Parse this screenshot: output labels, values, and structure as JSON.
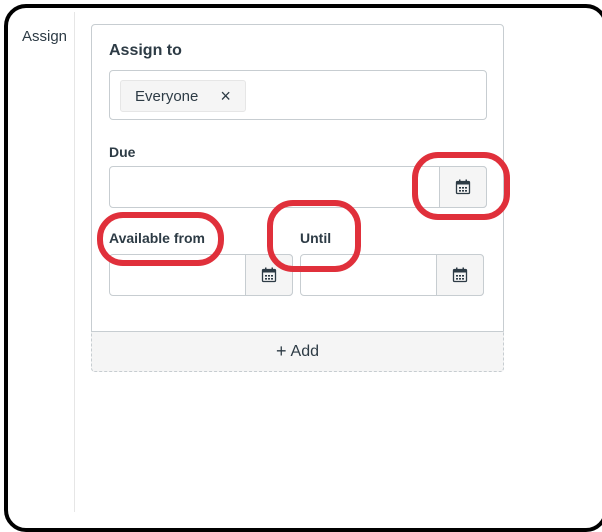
{
  "section": {
    "label": "Assign"
  },
  "card": {
    "title": "Assign to",
    "assignees": [
      {
        "label": "Everyone",
        "remove_glyph": "×"
      }
    ]
  },
  "due": {
    "label": "Due",
    "value": ""
  },
  "available_from": {
    "label": "Available from",
    "value": ""
  },
  "until": {
    "label": "Until",
    "value": ""
  },
  "add_button": {
    "plus": "+",
    "label": "Add"
  },
  "icons": {
    "calendar": "calendar-icon",
    "remove": "close-icon"
  },
  "colors": {
    "annotation": "#e0303b",
    "text": "#2d3b45",
    "border": "#c7cdd1",
    "button_bg": "#f5f5f5"
  }
}
